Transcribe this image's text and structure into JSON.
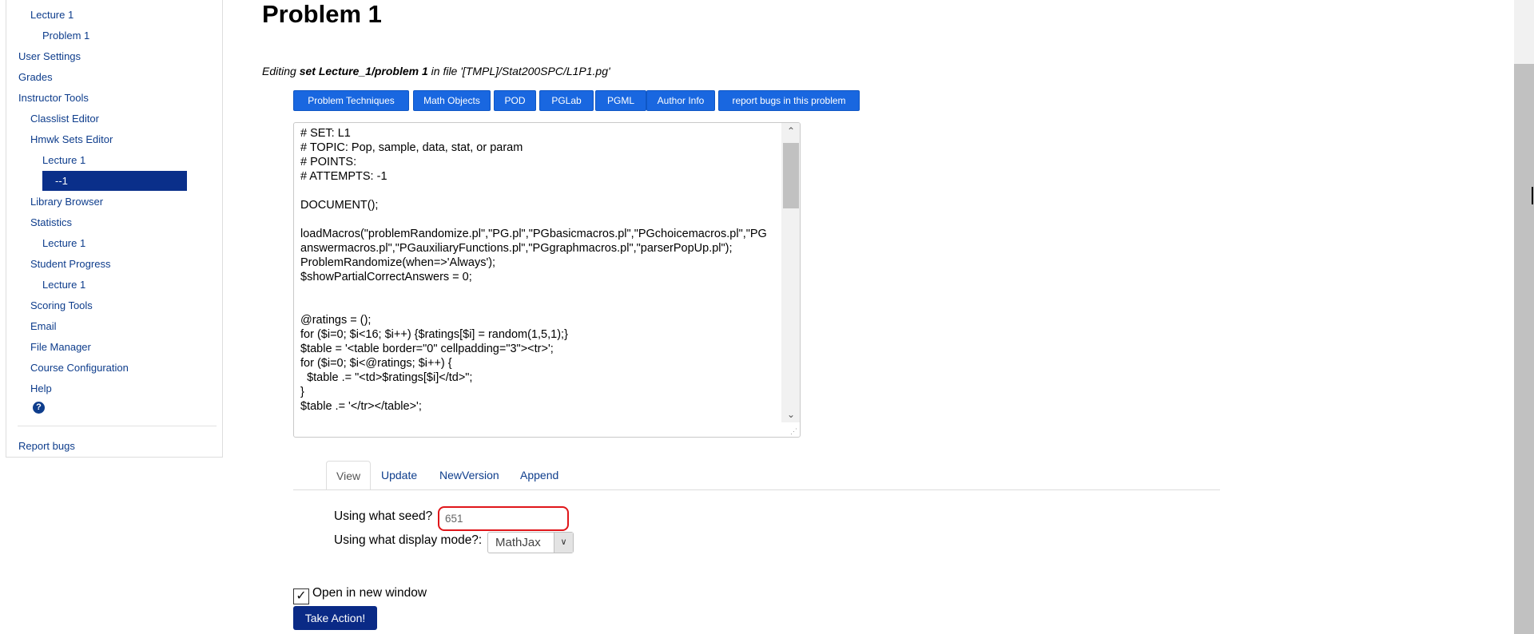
{
  "sidebar": {
    "items": [
      {
        "label": "Lecture 1",
        "level": 1
      },
      {
        "label": "Problem 1",
        "level": 2
      },
      {
        "label": "User Settings",
        "level": 0
      },
      {
        "label": "Grades",
        "level": 0
      },
      {
        "label": "Instructor Tools",
        "level": 0
      },
      {
        "label": "Classlist Editor",
        "level": 1
      },
      {
        "label": "Hmwk Sets Editor",
        "level": 1
      },
      {
        "label": "Lecture 1",
        "level": 2
      },
      {
        "label": "--1",
        "level": 2,
        "active": true
      },
      {
        "label": "Library Browser",
        "level": 1
      },
      {
        "label": "Statistics",
        "level": 1
      },
      {
        "label": "Lecture 1",
        "level": 2
      },
      {
        "label": "Student Progress",
        "level": 1
      },
      {
        "label": "Lecture 1",
        "level": 2
      },
      {
        "label": "Scoring Tools",
        "level": 1
      },
      {
        "label": "Email",
        "level": 1
      },
      {
        "label": "File Manager",
        "level": 1
      },
      {
        "label": "Course Configuration",
        "level": 1
      },
      {
        "label": "Help",
        "level": 1
      }
    ],
    "help_icon": "question-circle-icon",
    "report_bugs": "Report bugs"
  },
  "main": {
    "title": "Problem 1",
    "editing": {
      "prefix": "Editing ",
      "set_ref": "set Lecture_1/problem 1",
      "middle": " in file '",
      "file": "[TMPL]/Stat200SPC/L1P1.pg",
      "suffix": "'"
    },
    "toolbar": [
      "Problem Techniques",
      "Math Objects",
      "POD",
      "PGLab",
      "PGML",
      "Author Info",
      "report bugs in this problem"
    ],
    "code": "# SET: L1\n# TOPIC: Pop, sample, data, stat, or param\n# POINTS:\n# ATTEMPTS: -1\n\nDOCUMENT();\n\nloadMacros(\"problemRandomize.pl\",\"PG.pl\",\"PGbasicmacros.pl\",\"PGchoicemacros.pl\",\"PGanswermacros.pl\",\"PGauxiliaryFunctions.pl\",\"PGgraphmacros.pl\",\"parserPopUp.pl\");\nProblemRandomize(when=>'Always');\n$showPartialCorrectAnswers = 0;\n\n\n@ratings = ();\nfor ($i=0; $i<16; $i++) {$ratings[$i] = random(1,5,1);}\n$table = '<table border=\"0\" cellpadding=\"3\"><tr>';\nfor ($i=0; $i<@ratings; $i++) {\n  $table .= \"<td>$ratings[$i]</td>\";\n}\n$table .= '</tr></table>';",
    "tabs": [
      "View",
      "Update",
      "NewVersion",
      "Append"
    ],
    "active_tab": "View",
    "seed_label": "Using what seed?",
    "seed_value": "651",
    "display_mode_label": "Using what display mode?:",
    "display_mode_value": "MathJax",
    "open_new_window_label": "Open in new window",
    "open_new_window_checked": true,
    "take_action_label": "Take Action!"
  },
  "colors": {
    "link": "#0e3d8c",
    "toolbar_button": "#1967e0",
    "active_nav": "#0a2f8a",
    "take_action": "#0a2a86",
    "seed_highlight": "#e0161a"
  }
}
